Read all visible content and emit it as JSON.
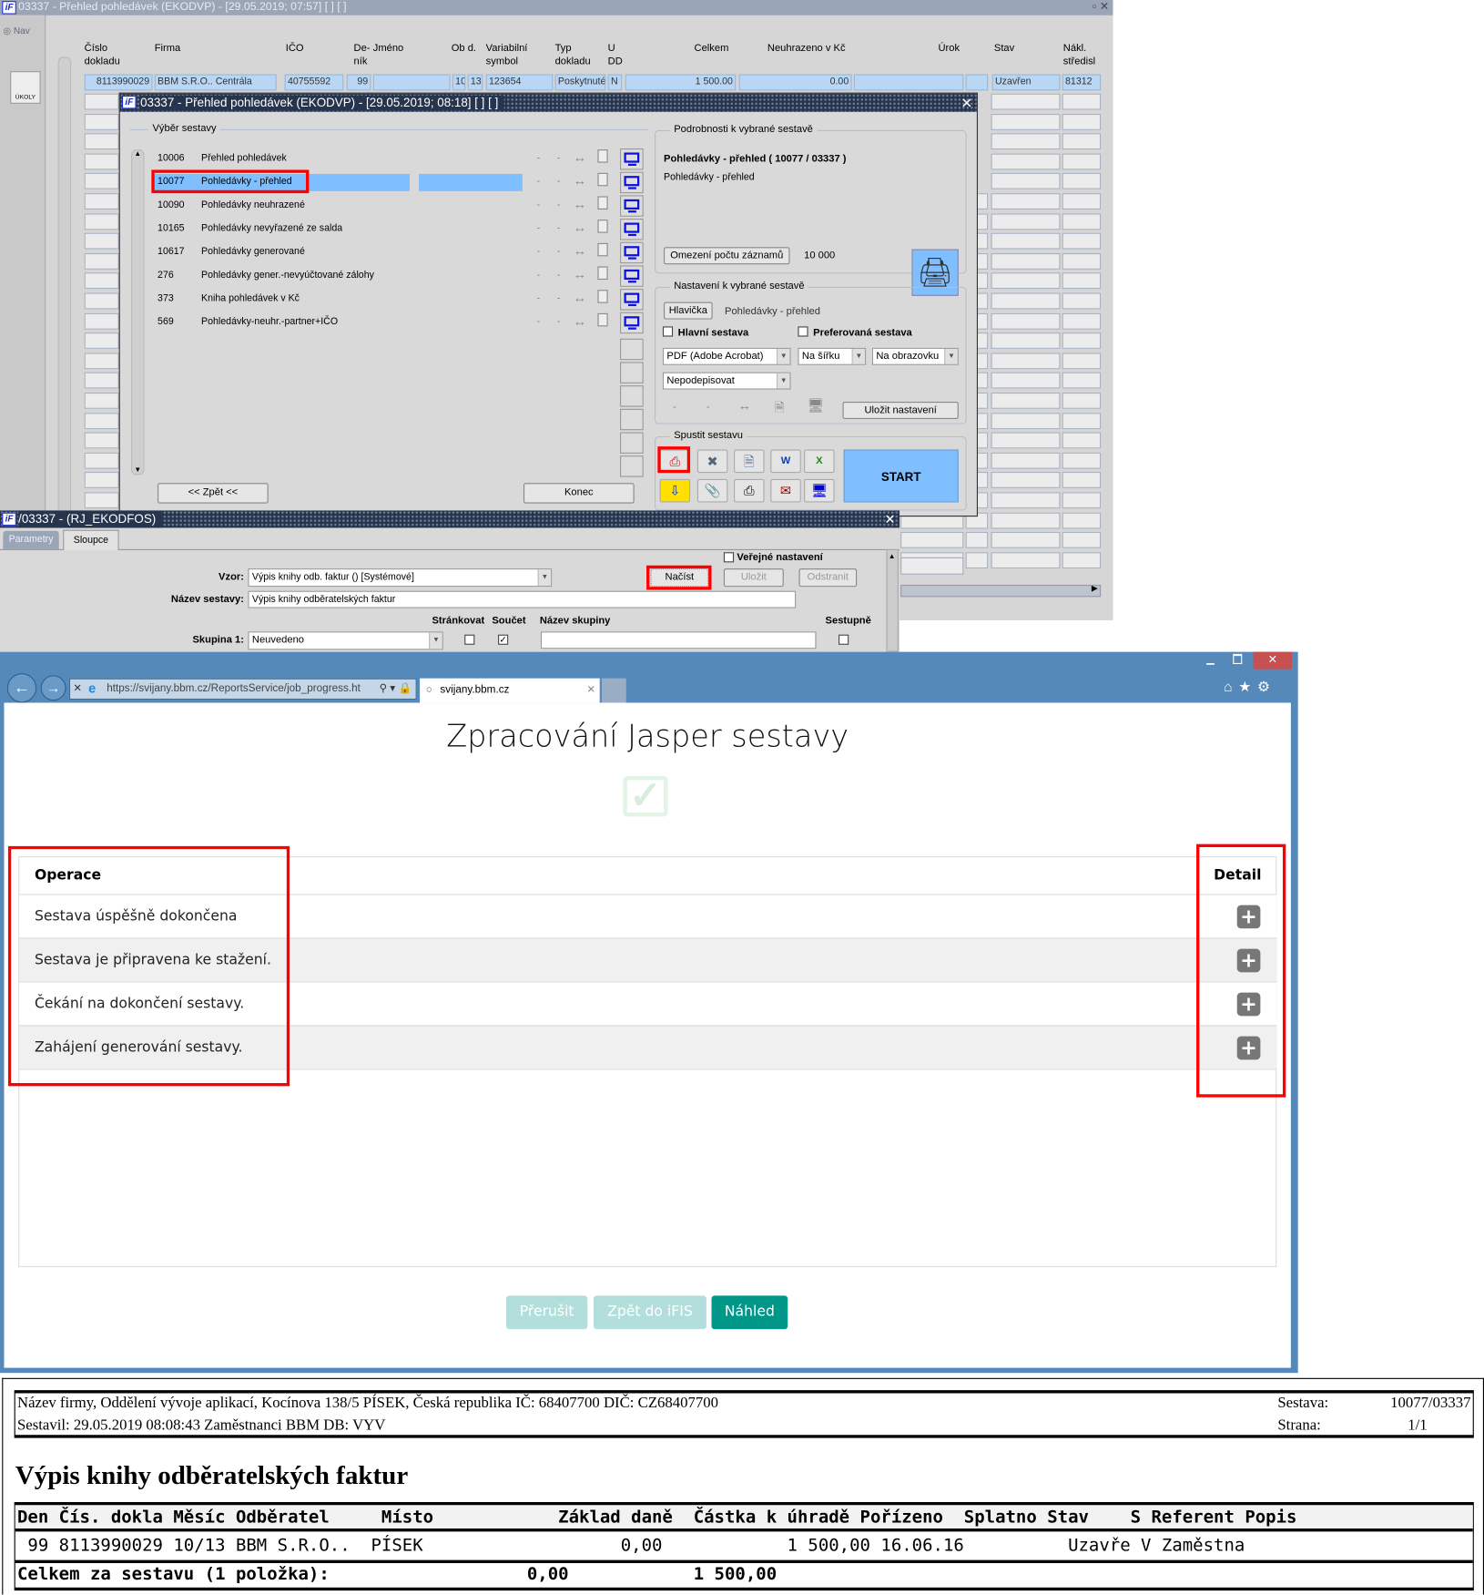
{
  "window1": {
    "title": "03337 - Přehled pohledávek (EKODVP) - [29.05.2019; 07:57]  [ ]  [ ]",
    "nav_label": "Nav",
    "tasks_label": "ÚKOLY",
    "columns": [
      [
        "Číslo",
        "dokladu"
      ],
      [
        "",
        "Firma"
      ],
      [
        "",
        "IČO"
      ],
      [
        "De-",
        "ník"
      ],
      [
        "",
        "Jméno"
      ],
      [
        "",
        "Ob d."
      ],
      [
        "Variabilní",
        "symbol"
      ],
      [
        "Typ",
        "dokladu"
      ],
      [
        "U",
        "DD"
      ],
      [
        "",
        "Celkem"
      ],
      [
        "",
        "Neuhrazeno v Kč"
      ],
      [
        "",
        "Úrok"
      ],
      [
        "",
        "Stav"
      ],
      [
        "Nákl.",
        "středisl"
      ]
    ],
    "row": [
      "8113990029",
      "BBM S.R.O.. Centrála",
      "40755592",
      "99",
      "",
      "10",
      "13",
      "123654",
      "Poskytnuté",
      "N",
      "1 500.00",
      "0.00",
      "",
      "",
      "Uzavřen",
      "81312"
    ]
  },
  "dialog": {
    "title": "03337 - Přehled pohledávek (EKODVP) - [29.05.2019; 08:18]  [ ]  [ ]",
    "select_group": "Výběr sestavy",
    "reports": [
      {
        "code": "10006",
        "name": "Přehled pohledávek"
      },
      {
        "code": "10077",
        "name": "Pohledávky - přehled"
      },
      {
        "code": "10090",
        "name": "Pohledávky neuhrazené"
      },
      {
        "code": "10165",
        "name": "Pohledávky nevyřazené ze salda"
      },
      {
        "code": "10617",
        "name": "Pohledávky generované"
      },
      {
        "code": "276",
        "name": "Pohledávky gener.-nevyúčtované zálohy"
      },
      {
        "code": "373",
        "name": "Kniha pohledávek v Kč"
      },
      {
        "code": "569",
        "name": "Pohledávky-neuhr.-partner+IČO"
      }
    ],
    "dash": "-",
    "arrow": "↔",
    "back_label": "<< Zpět <<",
    "end_label": "Konec",
    "details_group": "Podrobnosti k vybrané sestavě",
    "details_title": "Pohledávky - přehled ( 10077 / 03337 )",
    "details_sub": "Pohledávky - přehled",
    "limit_label": "Omezení počtu záznamů",
    "limit_value": "10 000",
    "settings_group": "Nastavení k vybrané sestavě",
    "header_btn": "Hlavička",
    "header_text": "Pohledávky - přehled",
    "main_report": "Hlavní sestava",
    "preferred_report": "Preferovaná sestava",
    "format": "PDF (Adobe Acrobat)",
    "orientation": "Na šířku",
    "output": "Na obrazovku",
    "signing": "Nepodepisovat",
    "save_settings": "Uložit nastavení",
    "run_group": "Spustit sestavu",
    "start_label": "START"
  },
  "window3": {
    "title": "/03337 - (RJ_EKODFOS)",
    "tabs": [
      "Parametry",
      "Sloupce"
    ],
    "public_setting": "Veřejné nastavení",
    "template_label": "Vzor:",
    "template_value": "Výpis knihy odb. faktur   ()   [Systémové]",
    "load": "Načíst",
    "save": "Uložit",
    "remove": "Odstranit",
    "name_label": "Název sestavy:",
    "name_value": "Výpis knihy odběratelských faktur",
    "col_paging": "Stránkovat",
    "col_sum": "Součet",
    "col_group_name": "Název skupiny",
    "col_desc": "Sestupně",
    "group1_label": "Skupina 1:",
    "group1_value": "Neuvedeno"
  },
  "browser": {
    "url": "https://svijany.bbm.cz/ReportsService/job_progress.ht",
    "tab": "svijany.bbm.cz",
    "heading": "Zpracování Jasper sestavy",
    "col_operation": "Operace",
    "col_detail": "Detail",
    "operations": [
      "Sestava úspěšně dokončena",
      "Sestava je připravena ke stažení.",
      "Čekání na dokončení sestavy.",
      "Zahájení generování sestavy."
    ],
    "btn_abort": "Přerušit",
    "btn_back": "Zpět do iFIS",
    "btn_preview": "Náhled",
    "colors": {
      "primary": "#009688",
      "disabled": "#b2dfdb",
      "frame": "#5589ba"
    }
  },
  "report": {
    "company": "Název firmy, Oddělení vývoje aplikací, Kocínova 138/5 PÍSEK, Česká republika  IČ: 68407700  DIČ: CZ68407700",
    "created": "Sestavil: 29.05.2019 08:08:43 Zaměstnanci BBM  DB: VYV",
    "report_label": "Sestava:",
    "report_value": "10077/03337",
    "page_label": "Strana:",
    "page_value": "1/1",
    "title": "Výpis knihy odběratelských faktur",
    "header": "Den Čís. dokla Měsíc Odběratel     Místo            Základ daně  Částka k úhradě Pořízeno  Splatno Stav    S Referent Popis",
    "row": " 99 8113990029 10/13 BBM S.R.O..  PÍSEK                   0,00            1 500,00 16.06.16          Uzavře V Zaměstna",
    "total": "Celkem za sestavu (1 položka):                   0,00            1 500,00"
  }
}
